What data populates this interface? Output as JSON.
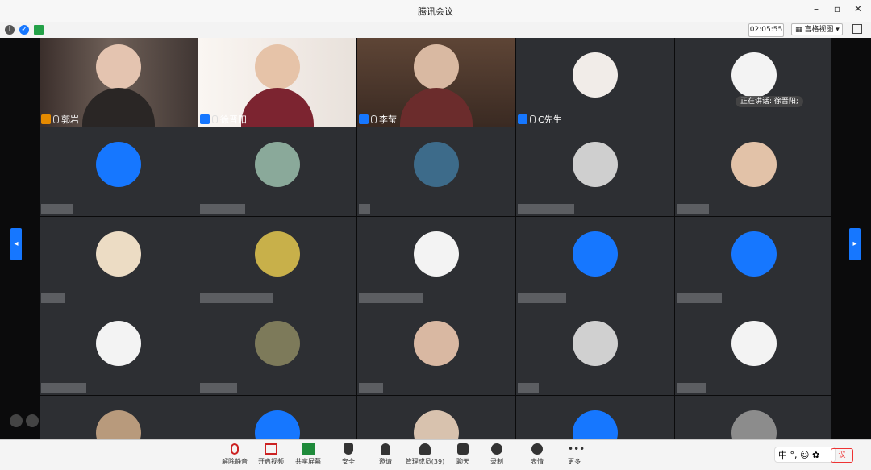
{
  "window": {
    "title": "腾讯会议"
  },
  "infobar": {
    "timer": "02:05:55",
    "view_label": "宫格视图"
  },
  "speaking": {
    "text": "正在讲话: 徐晋阳;"
  },
  "participants": [
    {
      "name": "郭岩"
    },
    {
      "name": "徐晋阳"
    },
    {
      "name": "李莹"
    },
    {
      "name": "C先生"
    }
  ],
  "ime": {
    "text": "中 °, ☺ ✿"
  },
  "end_button": {
    "label": "议"
  },
  "toolbar": {
    "unmute": "解除静音",
    "start_video": "开启视频",
    "share_screen": "共享屏幕",
    "security": "安全",
    "invite": "邀请",
    "manage_members": "管理成员(39)",
    "chat": "聊天",
    "record": "录制",
    "reactions": "表情",
    "more": "更多"
  },
  "colors": {
    "accent": "#1677ff",
    "tile_bg": "#2d2f33",
    "stage_bg": "#0b0b0c",
    "end": "#ee3333"
  }
}
